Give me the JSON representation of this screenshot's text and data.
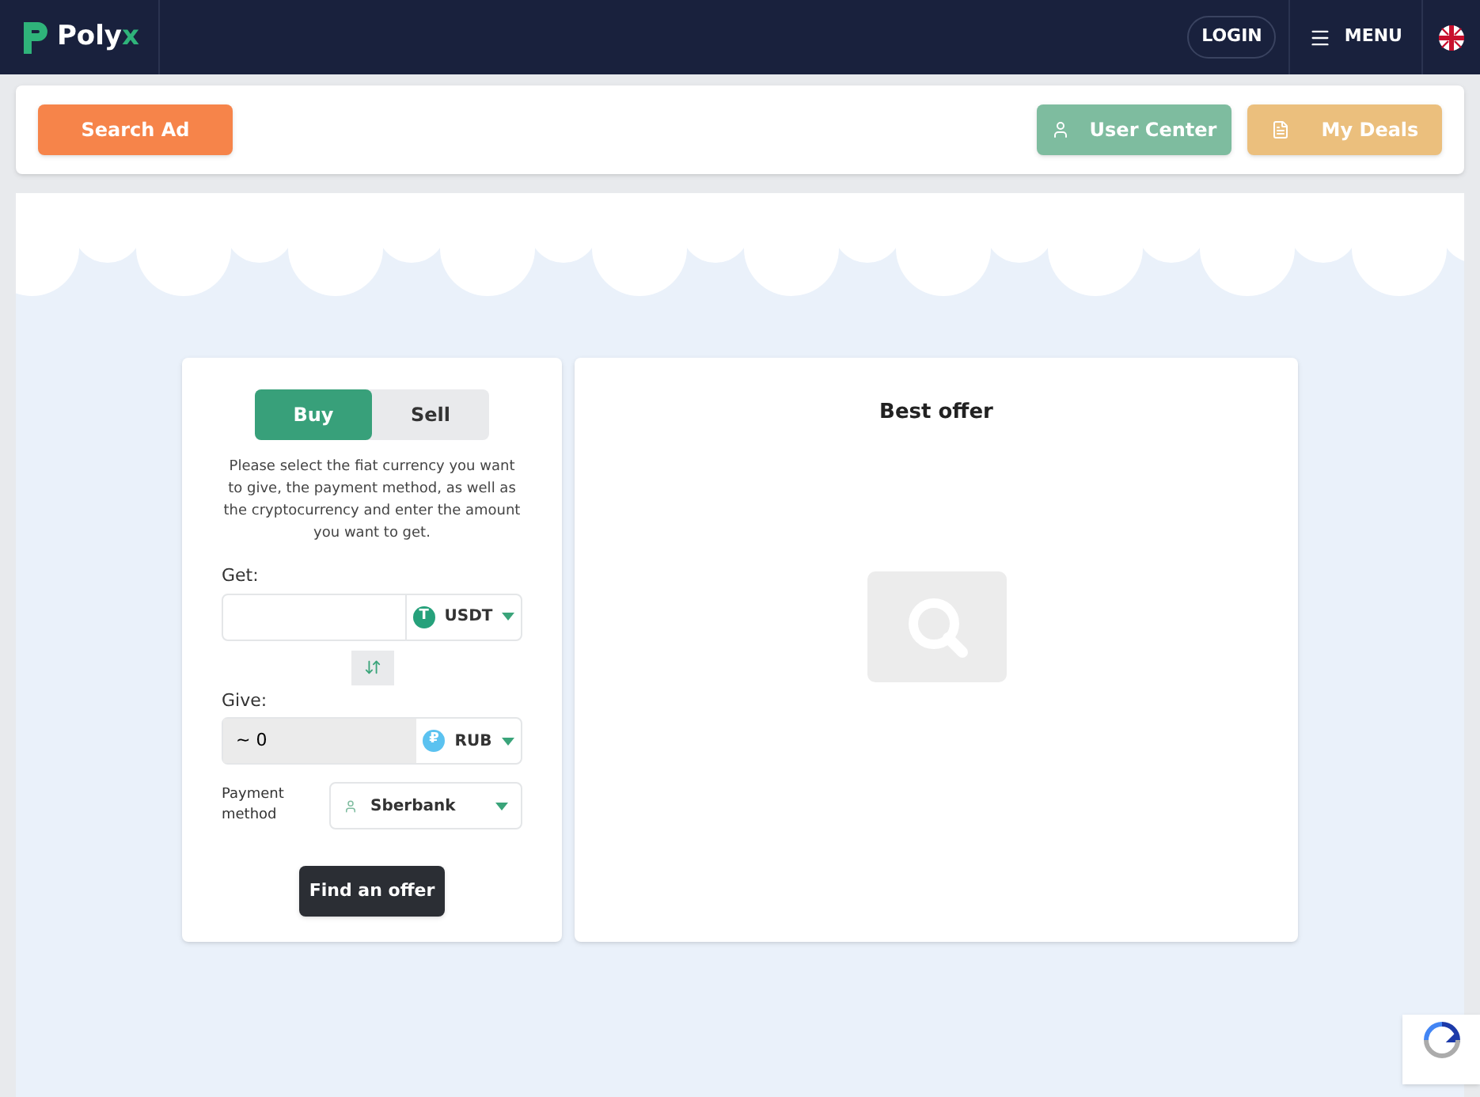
{
  "header": {
    "logo": "Poly",
    "logo_accent": "x",
    "login": "LOGIN",
    "menu": "MENU"
  },
  "toolbar": {
    "search": "Search Ad",
    "user_center": "User Center",
    "my_deals": "My Deals"
  },
  "form": {
    "tabs": [
      {
        "label": "Buy",
        "selected": true
      },
      {
        "label": "Sell",
        "selected": false
      }
    ],
    "instructions": "Please select the fiat currency you want to give, the payment method, as well as the cryptocurrency and enter the amount you want to get.",
    "get": {
      "label": "Get:",
      "currency": "USDT",
      "coin": "T"
    },
    "give": {
      "label": "Give:",
      "value": "~ 0",
      "currency": "RUB",
      "coin": "₽"
    },
    "payment": {
      "label": "Payment method",
      "value": "Sberbank"
    },
    "submit": "Find an offer"
  },
  "offer": {
    "title": "Best offer"
  }
}
